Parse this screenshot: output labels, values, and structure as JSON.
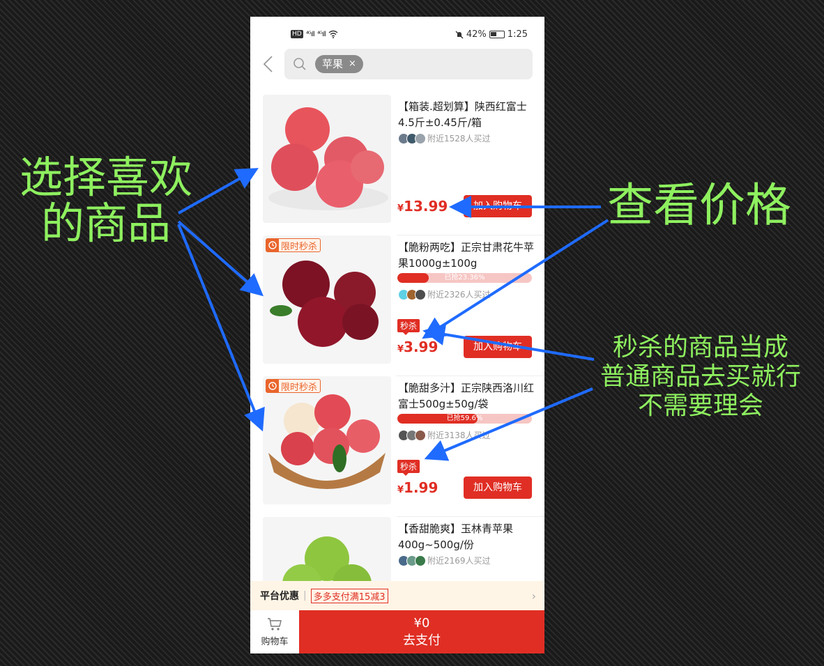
{
  "status": {
    "left": "HD",
    "sig1": "⁴ᴳıll",
    "sig2": "⁴ᴳıll",
    "battery_pct": "42%",
    "time": "1:25"
  },
  "search": {
    "chip": "苹果",
    "chip_close": "×"
  },
  "products": [
    {
      "title": "【箱装.超划算】陕西红富士4.5斤±0.45斤/箱",
      "buyers": "附近1528人买过",
      "price_symbol": "¥",
      "price": "13.99",
      "cart": "加入购物车"
    },
    {
      "flash": "限时秒杀",
      "title": "【脆粉两吃】正宗甘肃花牛苹果1000g±100g",
      "progress_text": "已抢23.36%",
      "progress": 0.2336,
      "buyers": "附近2326人买过",
      "seckill": "秒杀",
      "price_symbol": "¥",
      "price": "3.99",
      "cart": "加入购物车"
    },
    {
      "flash": "限时秒杀",
      "title": "【脆甜多汁】正宗陕西洛川红富士500g±50g/袋",
      "progress_text": "已抢59.6%",
      "progress": 0.596,
      "buyers": "附近3138人买过",
      "seckill": "秒杀",
      "price_symbol": "¥",
      "price": "1.99",
      "cart": "加入购物车"
    },
    {
      "title": "【香甜脆爽】玉林青苹果400g~500g/份",
      "buyers": "附近2169人买过"
    }
  ],
  "promo": {
    "label": "平台优惠",
    "divider": "|",
    "offer": "多多支付满15减3"
  },
  "bottom": {
    "cart_label": "购物车",
    "pay_amount": "¥0",
    "pay_label": "去支付"
  },
  "annotations": {
    "left_line1": "选择喜欢",
    "left_line2": "的商品",
    "right_top": "查看价格",
    "right_bottom_1": "秒杀的商品当成",
    "right_bottom_2": "普通商品去买就行",
    "right_bottom_3": "不需要理会"
  },
  "colors": {
    "accent": "#e02e24",
    "annotation": "#8ef05f",
    "arrow": "#1f6bff",
    "flash": "#e9652c"
  }
}
